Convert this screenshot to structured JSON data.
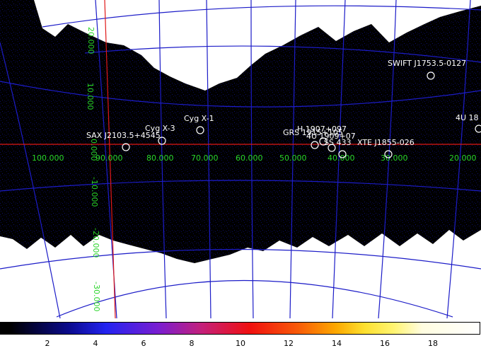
{
  "sky_map": {
    "ra_labels": [
      "100.000",
      "90.000",
      "80.000",
      "70.000",
      "60.000",
      "50.000",
      "40.000",
      "30.000",
      "20.000"
    ],
    "dec_labels": [
      "20.000",
      "10.000",
      "0.000",
      "-10.000",
      "-20.000",
      "-30.000"
    ],
    "sources": [
      {
        "name": "SAX J2103.5+4545"
      },
      {
        "name": "Cyg X-3"
      },
      {
        "name": "Cyg X-1"
      },
      {
        "name": "H 1907+097"
      },
      {
        "name": "GRS 1915+105"
      },
      {
        "name": "4U 1909+07"
      },
      {
        "name": "SS 433"
      },
      {
        "name": "XTE J1855-026"
      },
      {
        "name": "SWIFT J1753.5-0127"
      },
      {
        "name": "4U 18"
      }
    ],
    "colors": {
      "background": "#ffffff",
      "sky": "#000000",
      "grid": "#1c1cc8",
      "galactic_equator": "#e01818",
      "labels": "#2ad52a",
      "sources": "#ffffff"
    }
  },
  "colorbar": {
    "ticks": [
      "2",
      "4",
      "6",
      "8",
      "10",
      "12",
      "14",
      "16",
      "18"
    ],
    "colormap": "black-blue-purple-red-orange-yellow-white"
  }
}
